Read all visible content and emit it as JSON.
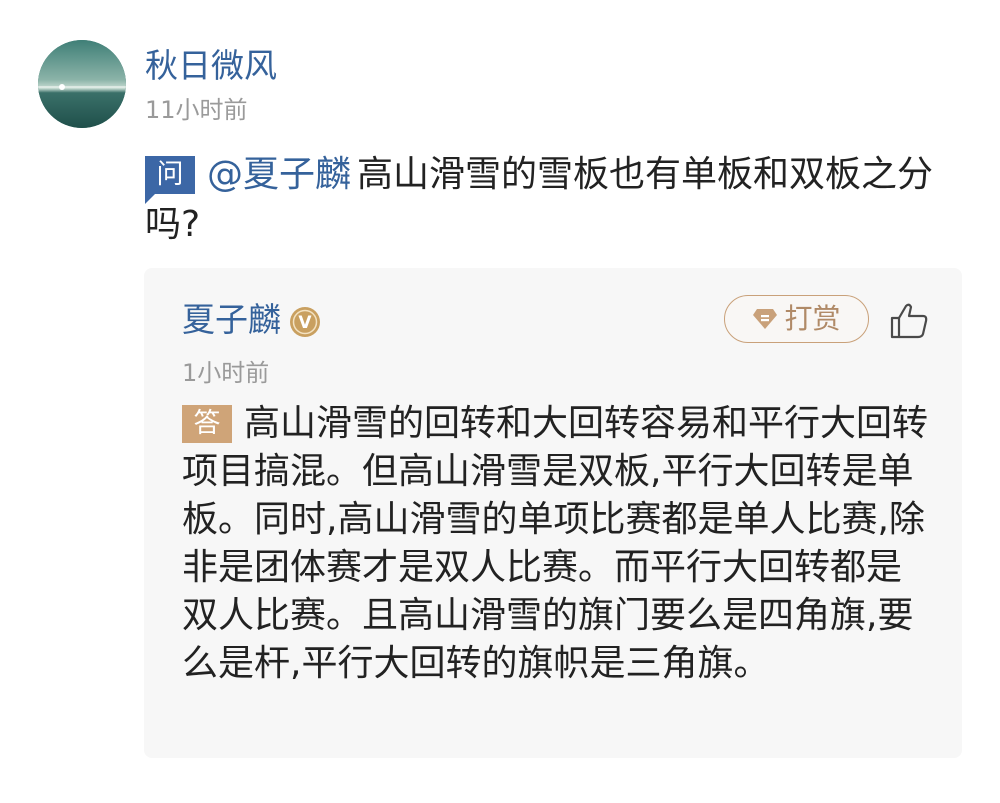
{
  "question_author": {
    "name": "秋日微风",
    "time": "11小时前"
  },
  "question": {
    "badge": "问",
    "mention": "@夏子麟",
    "text": "高山滑雪的雪板也有单板和双板之分吗?"
  },
  "answer": {
    "author_name": "夏子麟",
    "verified_badge": "V",
    "tip_label": "打赏",
    "time": "1小时前",
    "badge": "答",
    "text": "高山滑雪的回转和大回转容易和平行大回转项目搞混。但高山滑雪是双板,平行大回转是单板。同时,高山滑雪的单项比赛都是单人比赛,除非是团体赛才是双人比赛。而平行大回转都是双人比赛。且高山滑雪的旗门要么是四角旗,要么是杆,平行大回转的旗帜是三角旗。"
  },
  "icons": {
    "avatar": "landscape-avatar",
    "verified": "verified-v-icon",
    "tip": "gem-icon",
    "like": "thumbs-up-icon"
  },
  "colors": {
    "link_blue": "#35629b",
    "question_badge": "#3c67a6",
    "answer_badge": "#cfa478",
    "tip_gold": "#c9a17a",
    "meta_gray": "#9a9a9a",
    "card_bg": "#f7f7f7"
  }
}
